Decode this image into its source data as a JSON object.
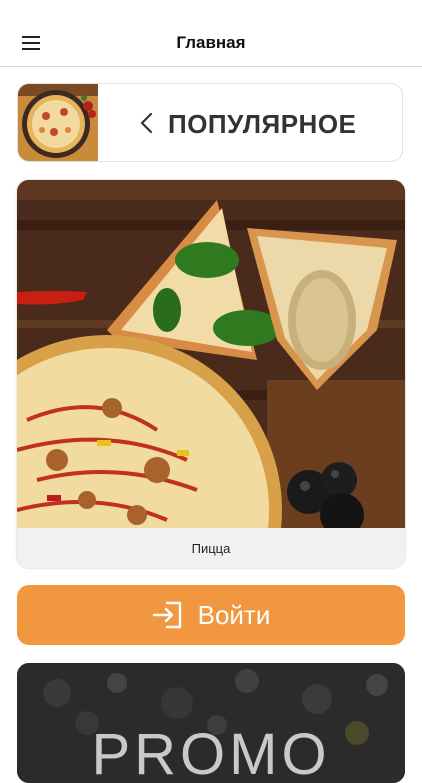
{
  "header": {
    "title": "Главная",
    "menu_icon": "hamburger-menu-icon"
  },
  "category": {
    "title": "ПОПУЛЯРНОЕ",
    "back_icon": "chevron-left-icon"
  },
  "product": {
    "label": "Пицца"
  },
  "login": {
    "label": "Войти",
    "icon": "login-icon"
  },
  "promo": {
    "text": "PROMO"
  },
  "colors": {
    "accent": "#f0973f",
    "label_bar": "#f1f1f1",
    "header_border": "#d8d8d8"
  }
}
